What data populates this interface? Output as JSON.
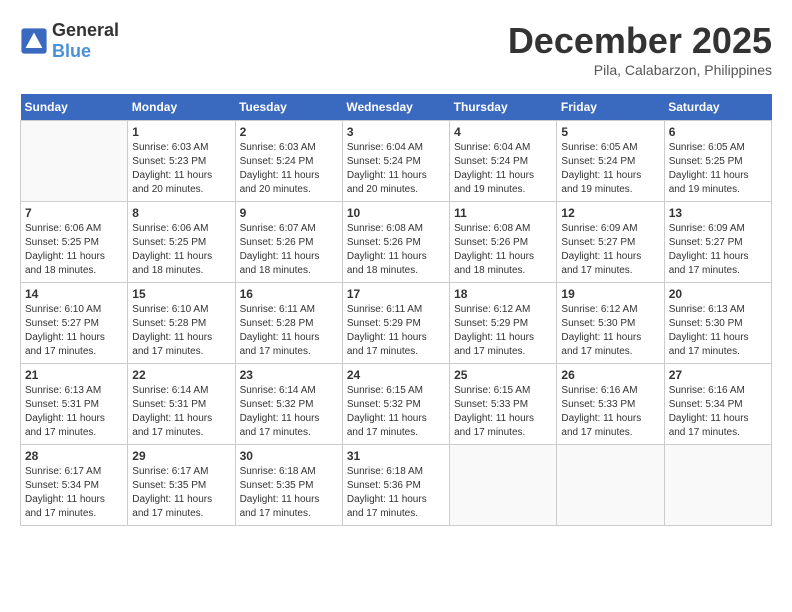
{
  "logo": {
    "text_general": "General",
    "text_blue": "Blue"
  },
  "header": {
    "month_year": "December 2025",
    "location": "Pila, Calabarzon, Philippines"
  },
  "columns": [
    "Sunday",
    "Monday",
    "Tuesday",
    "Wednesday",
    "Thursday",
    "Friday",
    "Saturday"
  ],
  "weeks": [
    [
      {
        "day": "",
        "info": ""
      },
      {
        "day": "1",
        "info": "Sunrise: 6:03 AM\nSunset: 5:23 PM\nDaylight: 11 hours\nand 20 minutes."
      },
      {
        "day": "2",
        "info": "Sunrise: 6:03 AM\nSunset: 5:24 PM\nDaylight: 11 hours\nand 20 minutes."
      },
      {
        "day": "3",
        "info": "Sunrise: 6:04 AM\nSunset: 5:24 PM\nDaylight: 11 hours\nand 20 minutes."
      },
      {
        "day": "4",
        "info": "Sunrise: 6:04 AM\nSunset: 5:24 PM\nDaylight: 11 hours\nand 19 minutes."
      },
      {
        "day": "5",
        "info": "Sunrise: 6:05 AM\nSunset: 5:24 PM\nDaylight: 11 hours\nand 19 minutes."
      },
      {
        "day": "6",
        "info": "Sunrise: 6:05 AM\nSunset: 5:25 PM\nDaylight: 11 hours\nand 19 minutes."
      }
    ],
    [
      {
        "day": "7",
        "info": "Sunrise: 6:06 AM\nSunset: 5:25 PM\nDaylight: 11 hours\nand 18 minutes."
      },
      {
        "day": "8",
        "info": "Sunrise: 6:06 AM\nSunset: 5:25 PM\nDaylight: 11 hours\nand 18 minutes."
      },
      {
        "day": "9",
        "info": "Sunrise: 6:07 AM\nSunset: 5:26 PM\nDaylight: 11 hours\nand 18 minutes."
      },
      {
        "day": "10",
        "info": "Sunrise: 6:08 AM\nSunset: 5:26 PM\nDaylight: 11 hours\nand 18 minutes."
      },
      {
        "day": "11",
        "info": "Sunrise: 6:08 AM\nSunset: 5:26 PM\nDaylight: 11 hours\nand 18 minutes."
      },
      {
        "day": "12",
        "info": "Sunrise: 6:09 AM\nSunset: 5:27 PM\nDaylight: 11 hours\nand 17 minutes."
      },
      {
        "day": "13",
        "info": "Sunrise: 6:09 AM\nSunset: 5:27 PM\nDaylight: 11 hours\nand 17 minutes."
      }
    ],
    [
      {
        "day": "14",
        "info": "Sunrise: 6:10 AM\nSunset: 5:27 PM\nDaylight: 11 hours\nand 17 minutes."
      },
      {
        "day": "15",
        "info": "Sunrise: 6:10 AM\nSunset: 5:28 PM\nDaylight: 11 hours\nand 17 minutes."
      },
      {
        "day": "16",
        "info": "Sunrise: 6:11 AM\nSunset: 5:28 PM\nDaylight: 11 hours\nand 17 minutes."
      },
      {
        "day": "17",
        "info": "Sunrise: 6:11 AM\nSunset: 5:29 PM\nDaylight: 11 hours\nand 17 minutes."
      },
      {
        "day": "18",
        "info": "Sunrise: 6:12 AM\nSunset: 5:29 PM\nDaylight: 11 hours\nand 17 minutes."
      },
      {
        "day": "19",
        "info": "Sunrise: 6:12 AM\nSunset: 5:30 PM\nDaylight: 11 hours\nand 17 minutes."
      },
      {
        "day": "20",
        "info": "Sunrise: 6:13 AM\nSunset: 5:30 PM\nDaylight: 11 hours\nand 17 minutes."
      }
    ],
    [
      {
        "day": "21",
        "info": "Sunrise: 6:13 AM\nSunset: 5:31 PM\nDaylight: 11 hours\nand 17 minutes."
      },
      {
        "day": "22",
        "info": "Sunrise: 6:14 AM\nSunset: 5:31 PM\nDaylight: 11 hours\nand 17 minutes."
      },
      {
        "day": "23",
        "info": "Sunrise: 6:14 AM\nSunset: 5:32 PM\nDaylight: 11 hours\nand 17 minutes."
      },
      {
        "day": "24",
        "info": "Sunrise: 6:15 AM\nSunset: 5:32 PM\nDaylight: 11 hours\nand 17 minutes."
      },
      {
        "day": "25",
        "info": "Sunrise: 6:15 AM\nSunset: 5:33 PM\nDaylight: 11 hours\nand 17 minutes."
      },
      {
        "day": "26",
        "info": "Sunrise: 6:16 AM\nSunset: 5:33 PM\nDaylight: 11 hours\nand 17 minutes."
      },
      {
        "day": "27",
        "info": "Sunrise: 6:16 AM\nSunset: 5:34 PM\nDaylight: 11 hours\nand 17 minutes."
      }
    ],
    [
      {
        "day": "28",
        "info": "Sunrise: 6:17 AM\nSunset: 5:34 PM\nDaylight: 11 hours\nand 17 minutes."
      },
      {
        "day": "29",
        "info": "Sunrise: 6:17 AM\nSunset: 5:35 PM\nDaylight: 11 hours\nand 17 minutes."
      },
      {
        "day": "30",
        "info": "Sunrise: 6:18 AM\nSunset: 5:35 PM\nDaylight: 11 hours\nand 17 minutes."
      },
      {
        "day": "31",
        "info": "Sunrise: 6:18 AM\nSunset: 5:36 PM\nDaylight: 11 hours\nand 17 minutes."
      },
      {
        "day": "",
        "info": ""
      },
      {
        "day": "",
        "info": ""
      },
      {
        "day": "",
        "info": ""
      }
    ]
  ]
}
